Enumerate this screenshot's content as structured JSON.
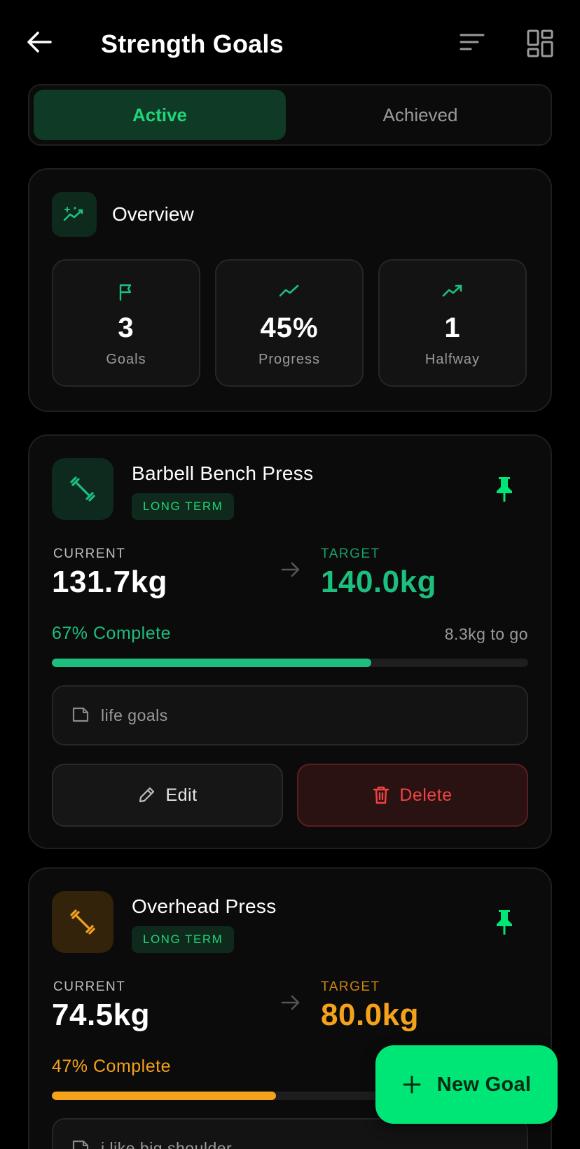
{
  "header": {
    "title": "Strength Goals",
    "back_icon": "arrow-left-icon",
    "sort_icon": "sort-icon",
    "layout_icon": "grid-layout-icon"
  },
  "tabs": [
    {
      "label": "Active",
      "selected": true
    },
    {
      "label": "Achieved",
      "selected": false
    }
  ],
  "overview": {
    "title": "Overview",
    "icon": "sparkle-chart-icon",
    "stats": [
      {
        "value": "3",
        "label": "Goals",
        "icon": "flag-icon"
      },
      {
        "value": "45%",
        "label": "Progress",
        "icon": "trend-line-icon"
      },
      {
        "value": "1",
        "label": "Halfway",
        "icon": "trending-up-icon"
      }
    ]
  },
  "goals": [
    {
      "name": "Barbell Bench Press",
      "badge": "LONG TERM",
      "current_label": "CURRENT",
      "current_value": "131.7kg",
      "target_label": "TARGET",
      "target_value": "140.0kg",
      "percent_text": "67% Complete",
      "progress": 0.67,
      "remaining": "8.3kg to go",
      "note": "life goals",
      "edit_label": "Edit",
      "delete_label": "Delete",
      "accent": "#1dbf7e",
      "icon_bg": "#0e2a1f",
      "icon": "dumbbell-icon"
    },
    {
      "name": "Overhead Press",
      "badge": "LONG TERM",
      "current_label": "CURRENT",
      "current_value": "74.5kg",
      "target_label": "TARGET",
      "target_value": "80.0kg",
      "percent_text": "47% Complete",
      "progress": 0.47,
      "note": "i like big shoulder",
      "accent": "#f5a21b",
      "icon_bg": "#33230b",
      "icon": "dumbbell-icon"
    }
  ],
  "fab": {
    "label": "New Goal",
    "icon": "plus-icon"
  },
  "colors": {
    "brand_green": "#00e676",
    "active_tab_bg": "#0f3a25",
    "delete_red": "#ef4444"
  }
}
